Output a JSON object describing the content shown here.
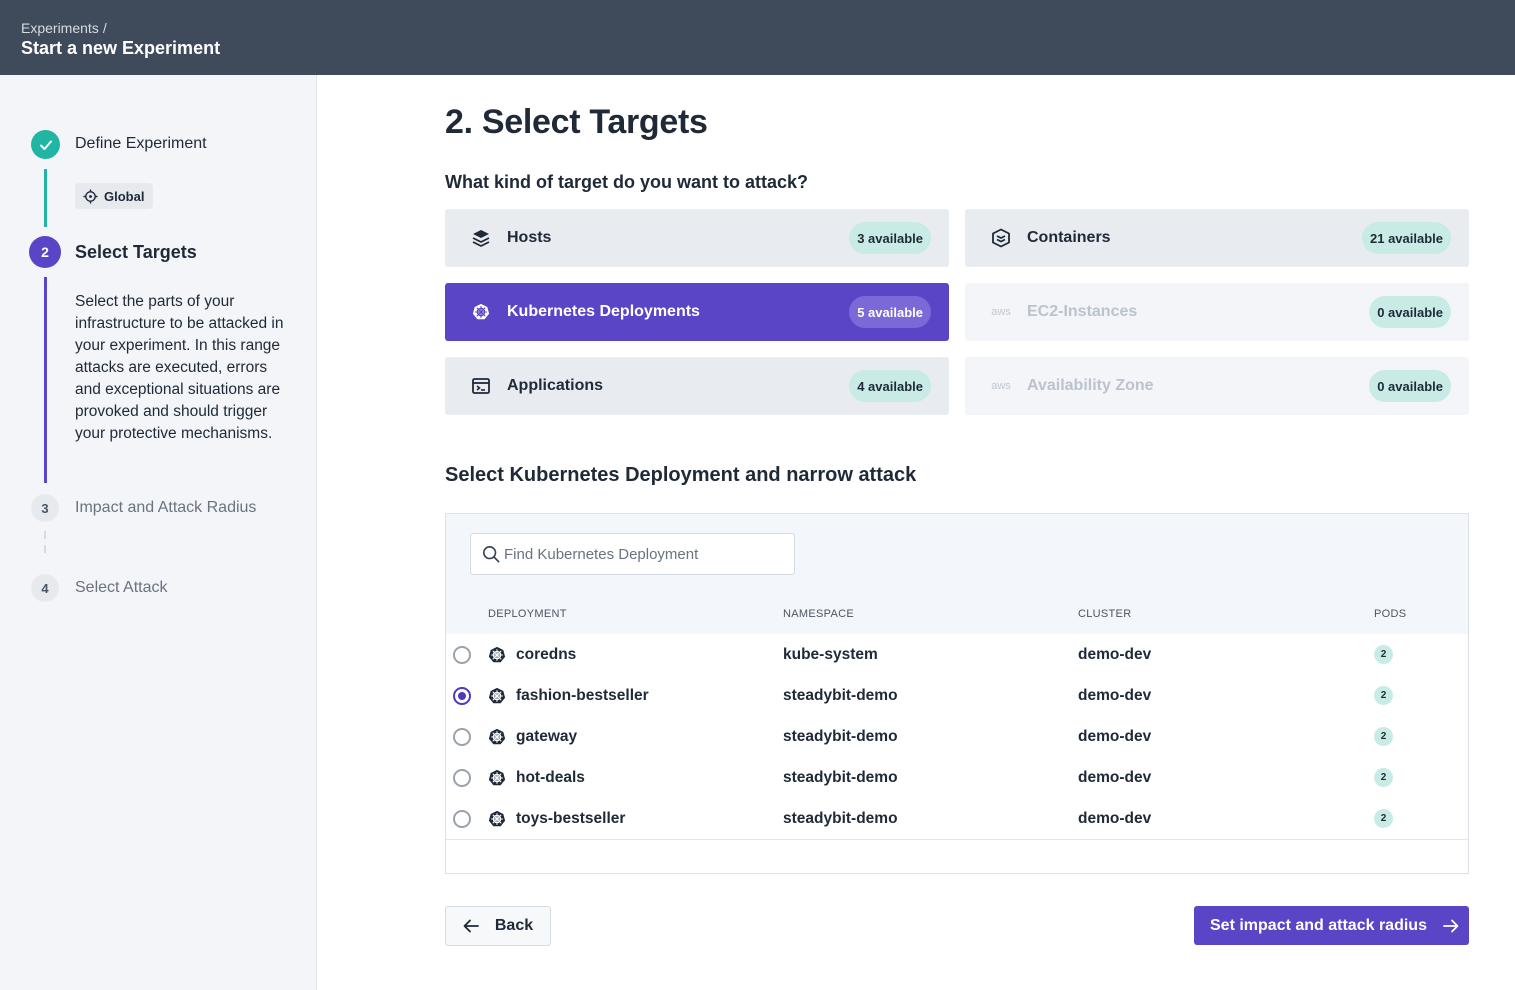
{
  "header": {
    "breadcrumb": "Experiments",
    "breadcrumb_sep": "/",
    "title": "Start a new Experiment"
  },
  "sidebar": {
    "steps": [
      {
        "number": "",
        "label": "Define Experiment",
        "state": "done"
      },
      {
        "number": "2",
        "label": "Select Targets",
        "state": "active"
      },
      {
        "number": "3",
        "label": "Impact and Attack Radius",
        "state": "pending"
      },
      {
        "number": "4",
        "label": "Select Attack",
        "state": "pending"
      }
    ],
    "environment_chip": "Global",
    "active_description": "Select the parts of your infrastructure to be attacked in your experiment. In this range attacks are executed, errors and exceptional situations are provoked and should trigger your protective mechanisms."
  },
  "main": {
    "title": "2. Select Targets",
    "question": "What kind of target do you want to attack?",
    "target_types": [
      {
        "label": "Hosts",
        "badge": "3 available",
        "icon": "layers-icon",
        "state": "normal"
      },
      {
        "label": "Containers",
        "badge": "21 available",
        "icon": "container-icon",
        "state": "normal"
      },
      {
        "label": "Kubernetes Deployments",
        "badge": "5 available",
        "icon": "kubernetes-icon",
        "state": "active"
      },
      {
        "label": "EC2-Instances",
        "badge": "0 available",
        "icon": "aws-icon",
        "icon_text": "aws",
        "state": "disabled"
      },
      {
        "label": "Applications",
        "badge": "4 available",
        "icon": "application-icon",
        "state": "normal"
      },
      {
        "label": "Availability Zone",
        "badge": "0 available",
        "icon": "aws-icon",
        "icon_text": "aws",
        "state": "disabled"
      }
    ],
    "section_title": "Select Kubernetes Deployment and narrow attack",
    "search": {
      "placeholder": "Find Kubernetes Deployment",
      "value": ""
    },
    "columns": [
      "DEPLOYMENT",
      "NAMESPACE",
      "CLUSTER",
      "PODS"
    ],
    "rows": [
      {
        "deployment": "coredns",
        "namespace": "kube-system",
        "cluster": "demo-dev",
        "pods": "2",
        "selected": false
      },
      {
        "deployment": "fashion-bestseller",
        "namespace": "steadybit-demo",
        "cluster": "demo-dev",
        "pods": "2",
        "selected": true
      },
      {
        "deployment": "gateway",
        "namespace": "steadybit-demo",
        "cluster": "demo-dev",
        "pods": "2",
        "selected": false
      },
      {
        "deployment": "hot-deals",
        "namespace": "steadybit-demo",
        "cluster": "demo-dev",
        "pods": "2",
        "selected": false
      },
      {
        "deployment": "toys-bestseller",
        "namespace": "steadybit-demo",
        "cluster": "demo-dev",
        "pods": "2",
        "selected": false
      }
    ],
    "back_label": "Back",
    "next_label": "Set impact and attack radius"
  },
  "colors": {
    "header_bg": "#3f4a5b",
    "accent": "#5b45c7",
    "done": "#22b5a3",
    "badge_bg": "#c8ebe6"
  }
}
